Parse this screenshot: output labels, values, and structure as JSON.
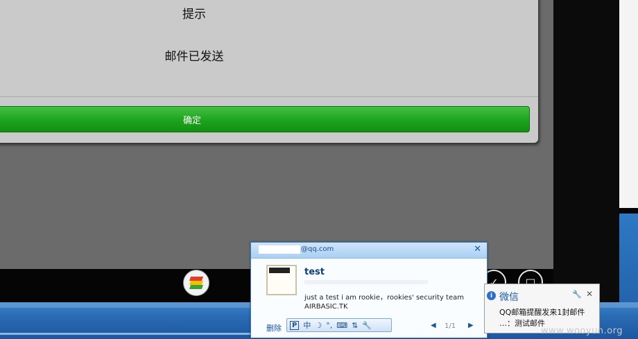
{
  "dialog": {
    "title": "提示",
    "message": "邮件已发送",
    "confirm_label": "确定"
  },
  "qq_popup": {
    "account_suffix": "@qq.com",
    "close_glyph": "✕",
    "subject": "test",
    "preview_line1": "just a test i am rookie，rookies' security team",
    "preview_line2": "AIRBASIC.TK",
    "delete_label": "删除",
    "ime_items": [
      "P",
      "中",
      "☽",
      "°,",
      "⌨",
      "⇅",
      "🔧"
    ],
    "pager_text": "1/1",
    "prev_glyph": "◀",
    "next_glyph": "▶"
  },
  "wechat_toast": {
    "title": "微信",
    "line1": "QQ邮箱提醒发来1封邮件",
    "line2": "…：测试邮件",
    "close_glyph": "✕",
    "wrench_glyph": "🔧"
  },
  "nav": {
    "back_glyph": "✓",
    "home_glyph": "□"
  },
  "watermark": "www.wooyun.org"
}
